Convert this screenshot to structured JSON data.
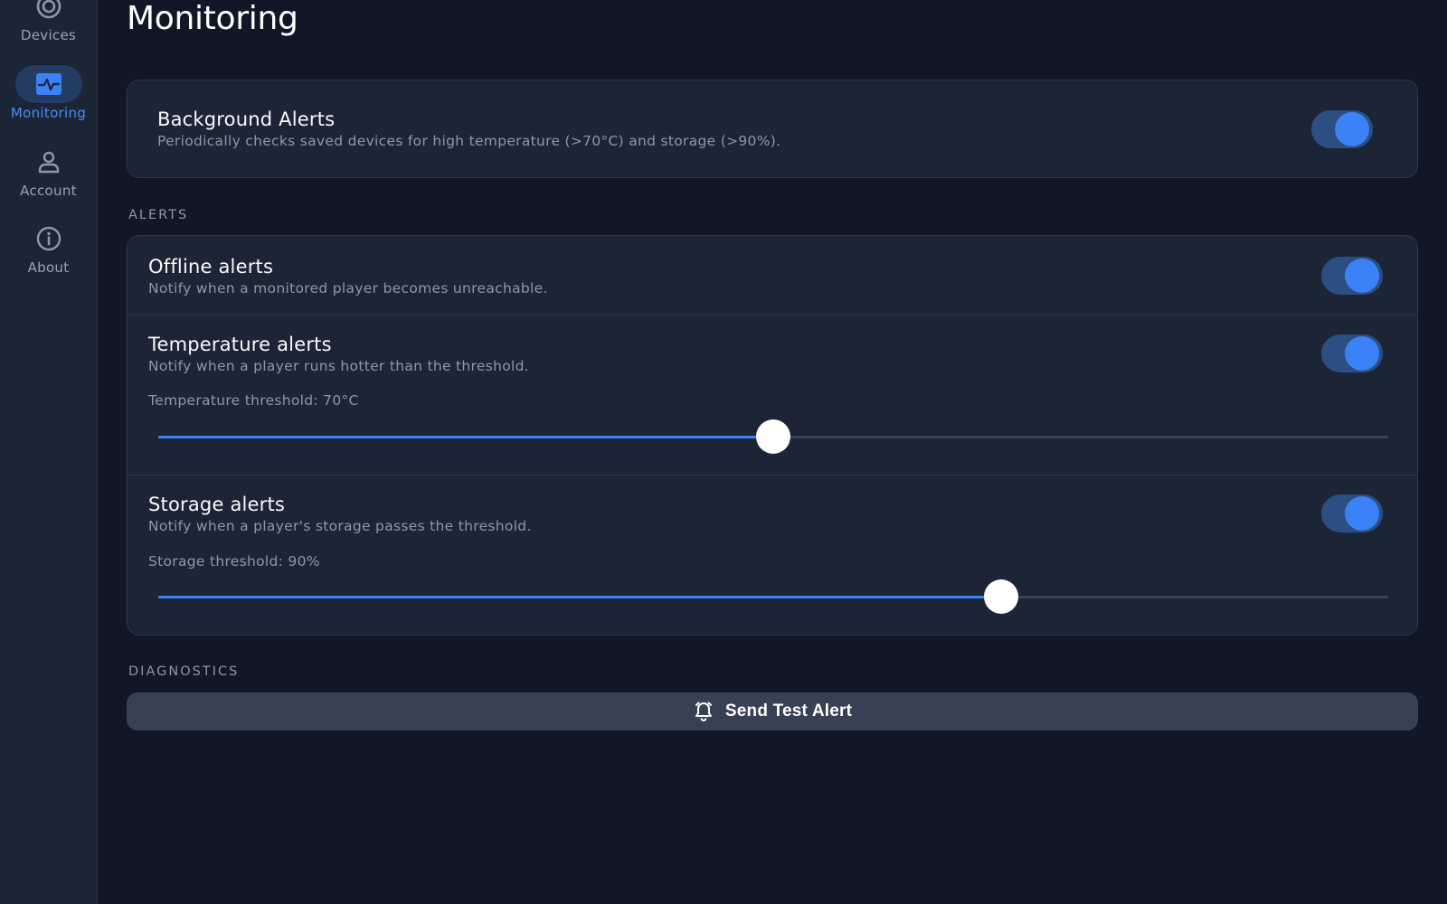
{
  "sidebar": {
    "items": [
      {
        "label": "Devices",
        "icon": "devices-icon",
        "active": false
      },
      {
        "label": "Monitoring",
        "icon": "monitoring-icon",
        "active": true
      },
      {
        "label": "Account",
        "icon": "account-icon",
        "active": false
      },
      {
        "label": "About",
        "icon": "info-icon",
        "active": false
      }
    ]
  },
  "page": {
    "title": "Monitoring"
  },
  "background_alerts": {
    "title": "Background Alerts",
    "description": "Periodically checks saved devices for high temperature (>70°C) and storage (>90%).",
    "enabled": true
  },
  "alerts": {
    "section_label": "ALERTS",
    "offline": {
      "title": "Offline alerts",
      "description": "Notify when a monitored player becomes unreachable.",
      "enabled": true
    },
    "temperature": {
      "title": "Temperature alerts",
      "description": "Notify when a player runs hotter than the threshold.",
      "threshold_label": "Temperature threshold: 70°C",
      "enabled": true,
      "slider_fraction": 0.5
    },
    "storage": {
      "title": "Storage alerts",
      "description": "Notify when a player's storage passes the threshold.",
      "threshold_label": "Storage threshold: 90%",
      "enabled": true,
      "slider_fraction": 0.685
    }
  },
  "diagnostics": {
    "section_label": "DIAGNOSTICS",
    "button_label": "Send Test Alert",
    "button_icon": "alarm-bell-icon"
  },
  "colors": {
    "accent": "#3b82f6",
    "background": "#101828",
    "surface": "#1c2535"
  }
}
